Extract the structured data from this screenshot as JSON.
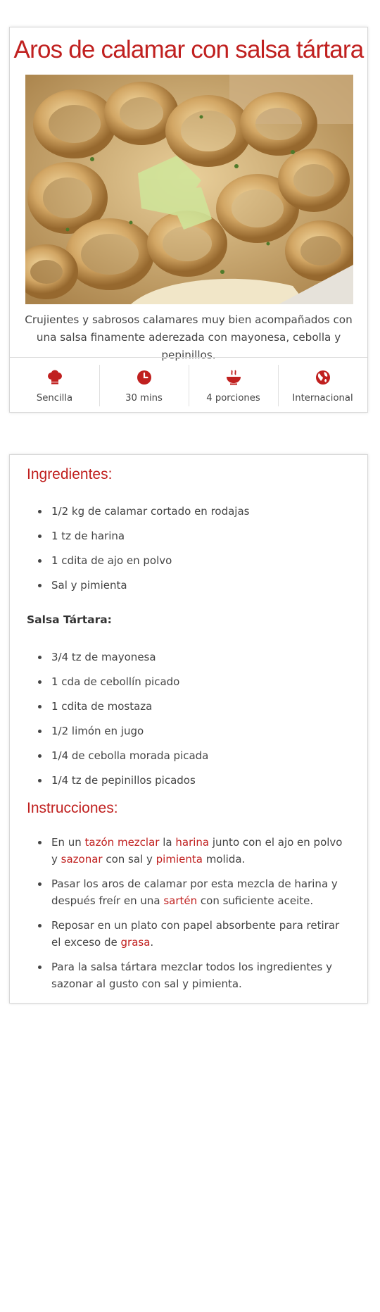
{
  "recipe": {
    "title": "Aros de calamar con salsa tártara",
    "description": "Crujientes y sabrosos calamares muy bien acompañados con una salsa finamente aderezada con mayonesa, cebolla y pepinillos."
  },
  "meta": [
    {
      "icon": "chef-hat-icon",
      "label": "Sencilla"
    },
    {
      "icon": "clock-icon",
      "label": "30 mins"
    },
    {
      "icon": "bowl-icon",
      "label": "4 porciones"
    },
    {
      "icon": "globe-icon",
      "label": "Internacional"
    }
  ],
  "ingredients": {
    "title": "Ingredientes:",
    "items": [
      "1/2 kg de calamar cortado en rodajas",
      "1 tz de harina",
      "1 cdita de ajo en polvo",
      "Sal y pimienta"
    ],
    "sauce_title": "Salsa Tártara:",
    "sauce_items": [
      "3/4 tz de mayonesa",
      "1 cda de cebollín picado",
      "1 cdita de mostaza",
      "1/2 limón en jugo",
      "1/4 de cebolla morada picada",
      "1/4 tz de pepinillos picados"
    ]
  },
  "instructions": {
    "title": "Instrucciones:",
    "steps": [
      {
        "segments": [
          {
            "text": "En un ",
            "link": false
          },
          {
            "text": "tazón",
            "link": true
          },
          {
            "text": " ",
            "link": false
          },
          {
            "text": "mezclar",
            "link": true
          },
          {
            "text": " la ",
            "link": false
          },
          {
            "text": "harina",
            "link": true
          },
          {
            "text": " junto con el ajo en polvo y ",
            "link": false
          },
          {
            "text": "sazonar",
            "link": true
          },
          {
            "text": " con sal y ",
            "link": false
          },
          {
            "text": "pimienta",
            "link": true
          },
          {
            "text": " molida.",
            "link": false
          }
        ]
      },
      {
        "segments": [
          {
            "text": "Pasar los aros de calamar por esta mezcla de harina y después freír en una ",
            "link": false
          },
          {
            "text": "sartén",
            "link": true
          },
          {
            "text": " con suficiente aceite.",
            "link": false
          }
        ]
      },
      {
        "segments": [
          {
            "text": "Reposar en un plato con papel absorbente para retirar el exceso de ",
            "link": false
          },
          {
            "text": "grasa",
            "link": true
          },
          {
            "text": ".",
            "link": false
          }
        ]
      },
      {
        "segments": [
          {
            "text": "Para la salsa tártara mezclar todos los ingredientes y sazonar al gusto con sal y pimienta.",
            "link": false
          }
        ]
      }
    ]
  },
  "colors": {
    "accent": "#c0201f",
    "text": "#444444",
    "border": "#d8d8d8"
  }
}
